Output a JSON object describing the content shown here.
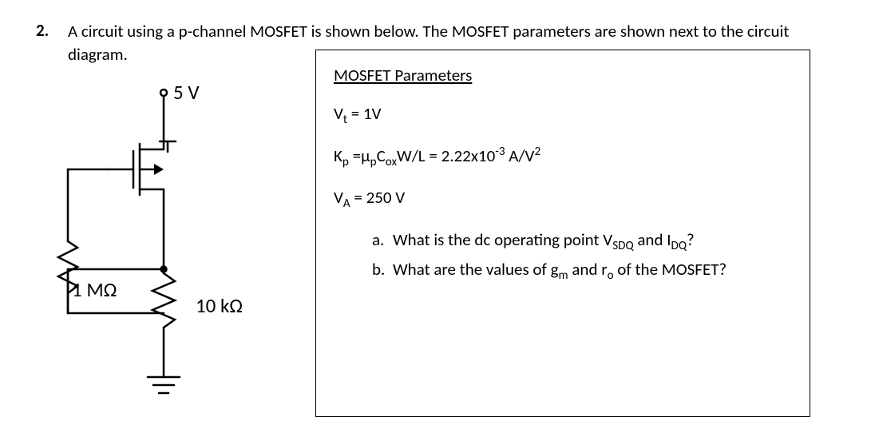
{
  "problem": {
    "number": "2.",
    "text": "A circuit using a p-channel MOSFET is shown below. The MOSFET parameters are shown next to the circuit diagram."
  },
  "circuit": {
    "supply_label": "5 V",
    "r1_label": "1 MΩ",
    "r2_label": "10 kΩ"
  },
  "params": {
    "title": "MOSFET Parameters",
    "vt": {
      "pre": "V",
      "sub": "t",
      "rest": " = 1V"
    },
    "kp": {
      "pre": "K",
      "sub": "p",
      "mid": " =µ",
      "sub2": "p",
      "mid2": "C",
      "sub3": "ox",
      "mid3": "W/L = 2.22x10",
      "sup": "-3",
      "rest": " A/V",
      "sup2": "2"
    },
    "va": {
      "pre": "V",
      "sub": "A",
      "rest": " = 250 V"
    }
  },
  "questions": {
    "a": {
      "letter": "a.",
      "text_pre": "What is the dc operating point V",
      "sub1": "SDQ",
      "mid": " and I",
      "sub2": "DQ",
      "post": "?"
    },
    "b": {
      "letter": "b.",
      "text_pre": "What are the values of g",
      "sub1": "m",
      "mid": " and r",
      "sub2": "o",
      "post": " of the MOSFET?"
    }
  }
}
